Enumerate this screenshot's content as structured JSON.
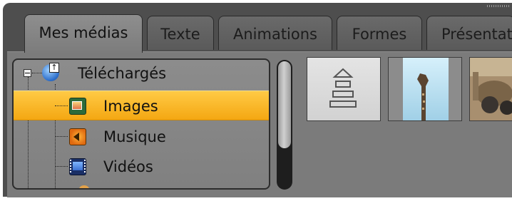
{
  "tabs": [
    {
      "label": "Mes médias",
      "active": true
    },
    {
      "label": "Texte",
      "active": false
    },
    {
      "label": "Animations",
      "active": false
    },
    {
      "label": "Formes",
      "active": false
    },
    {
      "label": "Présentati",
      "active": false
    }
  ],
  "tree": {
    "root": {
      "label": "Téléchargés",
      "icon": "globe-upload-icon",
      "expanded": true
    },
    "items": [
      {
        "label": "Images",
        "icon": "image-icon",
        "selected": true
      },
      {
        "label": "Musique",
        "icon": "speaker-icon",
        "selected": false
      },
      {
        "label": "Vidéos",
        "icon": "film-icon",
        "selected": false
      }
    ]
  },
  "thumbnails": [
    {
      "name": "upload-placeholder-icon"
    },
    {
      "name": "giraffe-photo"
    },
    {
      "name": "animal-photo"
    }
  ],
  "colors": {
    "accent": "#f6ad1c",
    "panel": "#4e4e4e",
    "content": "#7b7b7b"
  }
}
